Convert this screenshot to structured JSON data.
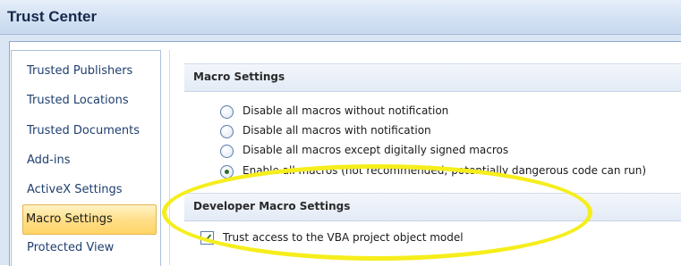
{
  "window": {
    "title": "Trust Center"
  },
  "sidebar": {
    "items": [
      {
        "label": "Trusted Publishers",
        "selected": false
      },
      {
        "label": "Trusted Locations",
        "selected": false
      },
      {
        "label": "Trusted Documents",
        "selected": false
      },
      {
        "label": "Add-ins",
        "selected": false
      },
      {
        "label": "ActiveX Settings",
        "selected": false
      },
      {
        "label": "Macro Settings",
        "selected": true
      },
      {
        "label": "Protected View",
        "selected": false
      }
    ]
  },
  "macro_settings": {
    "header": "Macro Settings",
    "options": [
      {
        "label": "Disable all macros without notification",
        "selected": false
      },
      {
        "label": "Disable all macros with notification",
        "selected": false
      },
      {
        "label": "Disable all macros except digitally signed macros",
        "selected": false
      },
      {
        "label": "Enable all macros (not recommended; potentially dangerous code can run)",
        "selected": true
      }
    ]
  },
  "developer_settings": {
    "header": "Developer Macro Settings",
    "checkbox_label": "Trust access to the VBA project object model",
    "checked": true
  },
  "colors": {
    "highlight_ring": "#f5ee1c",
    "selected_item": "#ffdf8a",
    "title_text": "#15294a"
  }
}
